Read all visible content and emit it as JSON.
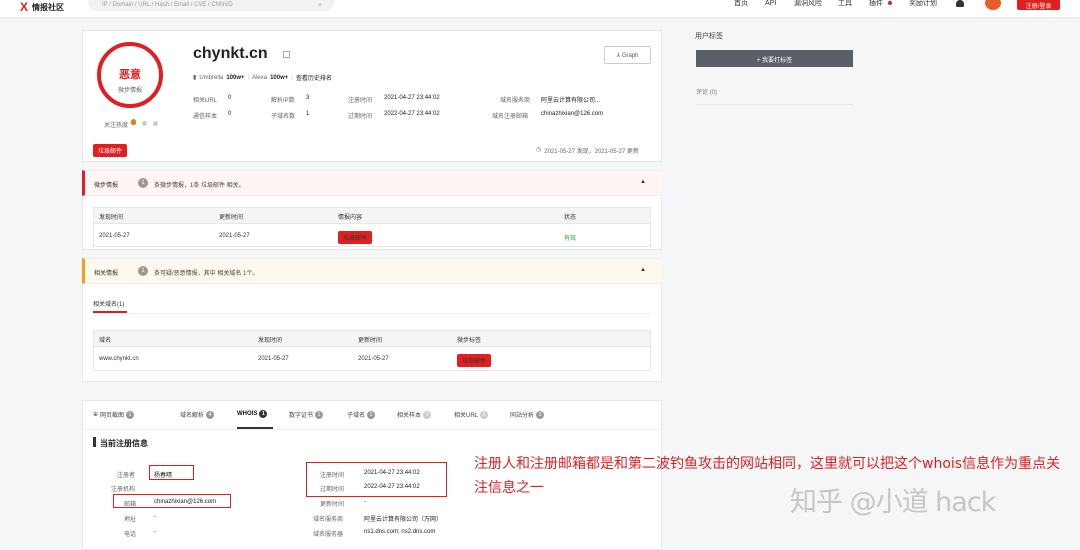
{
  "topbar": {
    "logo": "情报社区",
    "search_placeholder": "IP / Domain / URL / Hash / Email / CVE / CNNVD",
    "nav": [
      "首页",
      "API",
      "漏洞风险",
      "工具",
      "插件",
      "奖励计划"
    ],
    "login": "注册/登录"
  },
  "header": {
    "verdict": "恶意",
    "verdict_sub": "微步情报",
    "domain": "chynkt.cn",
    "graph_btn": "Graph",
    "rank_umbrella_label": "Umbrella",
    "rank_umbrella": "100w+",
    "rank_alexa_label": "Alexa",
    "rank_alexa": "100w+",
    "rank_history": "查看历史排名",
    "follow_label": "关注热度",
    "tag": "垃圾邮件",
    "time_note": "2021-05-27 发现，2021-05-27 更新",
    "stats": [
      {
        "label": "相关URL",
        "value": "0"
      },
      {
        "label": "解析IP数",
        "value": "3"
      },
      {
        "label": "注册时间",
        "value": "2021-04-27 23:44:02"
      },
      {
        "label": "域名服务商",
        "value": "阿里云计算有限公司..."
      },
      {
        "label": "通信样本",
        "value": "0"
      },
      {
        "label": "子域名数",
        "value": "1"
      },
      {
        "label": "过期时间",
        "value": "2022-04-27 23:44:02"
      },
      {
        "label": "域名注册邮箱",
        "value": "chinazhixian@126.com"
      }
    ]
  },
  "intel": {
    "title": "微步情报",
    "count": "1",
    "desc": "条微步情报，1条 垃圾邮件 相关。",
    "headers": [
      "发现时间",
      "更新时间",
      "情报内容",
      "状态"
    ],
    "row": {
      "found": "2021-05-27",
      "updated": "2021-05-27",
      "content": "垃圾邮件",
      "status": "有效"
    }
  },
  "related": {
    "title": "相关情报",
    "count": "1",
    "desc": "条可疑/恶意情报，其中 相关域名 1个。",
    "tab": "相关域名(1)",
    "headers": [
      "域名",
      "发现时间",
      "更新时间",
      "微步标签"
    ],
    "row": {
      "domain": "www.chynkt.cn",
      "found": "2021-05-27",
      "updated": "2021-05-27",
      "tag": "垃圾邮件"
    }
  },
  "tabs": [
    {
      "label": "网页截图",
      "count": "1"
    },
    {
      "label": "域名解析",
      "count": "4"
    },
    {
      "label": "WHOIS",
      "count": "1"
    },
    {
      "label": "数字证书",
      "count": "1"
    },
    {
      "label": "子域名",
      "count": "1"
    },
    {
      "label": "相关样本",
      "count": "0"
    },
    {
      "label": "相关URL",
      "count": "0"
    },
    {
      "label": "同站分析",
      "count": "3"
    }
  ],
  "whois": {
    "title": "当前注册信息",
    "left": [
      {
        "label": "注册者",
        "value": "杨春晴"
      },
      {
        "label": "注册机构",
        "value": ""
      },
      {
        "label": "邮箱",
        "value": "chinazhixian@126.com"
      },
      {
        "label": "地址",
        "value": "-"
      },
      {
        "label": "电话",
        "value": "-"
      }
    ],
    "right": [
      {
        "label": "注册时间",
        "value": "2021-04-27 23:44:02"
      },
      {
        "label": "过期时间",
        "value": "2022-04-27 23:44:02"
      },
      {
        "label": "更新时间",
        "value": "-"
      },
      {
        "label": "域名服务商",
        "value": "阿里云计算有限公司（万网）"
      },
      {
        "label": "域名服务器",
        "value": "ns1.dns.com; ns2.dns.com"
      }
    ]
  },
  "sidebar": {
    "user_tags": "用户标签",
    "add_tag_btn": "+ 我要打标签",
    "comments": "评论 (0)"
  },
  "annotation": "注册人和注册邮箱都是和第二波钓鱼攻击的网站相同，这里就可以把这个whois信息作为重点关注信息之一",
  "watermark": "知乎 @小道 hack"
}
